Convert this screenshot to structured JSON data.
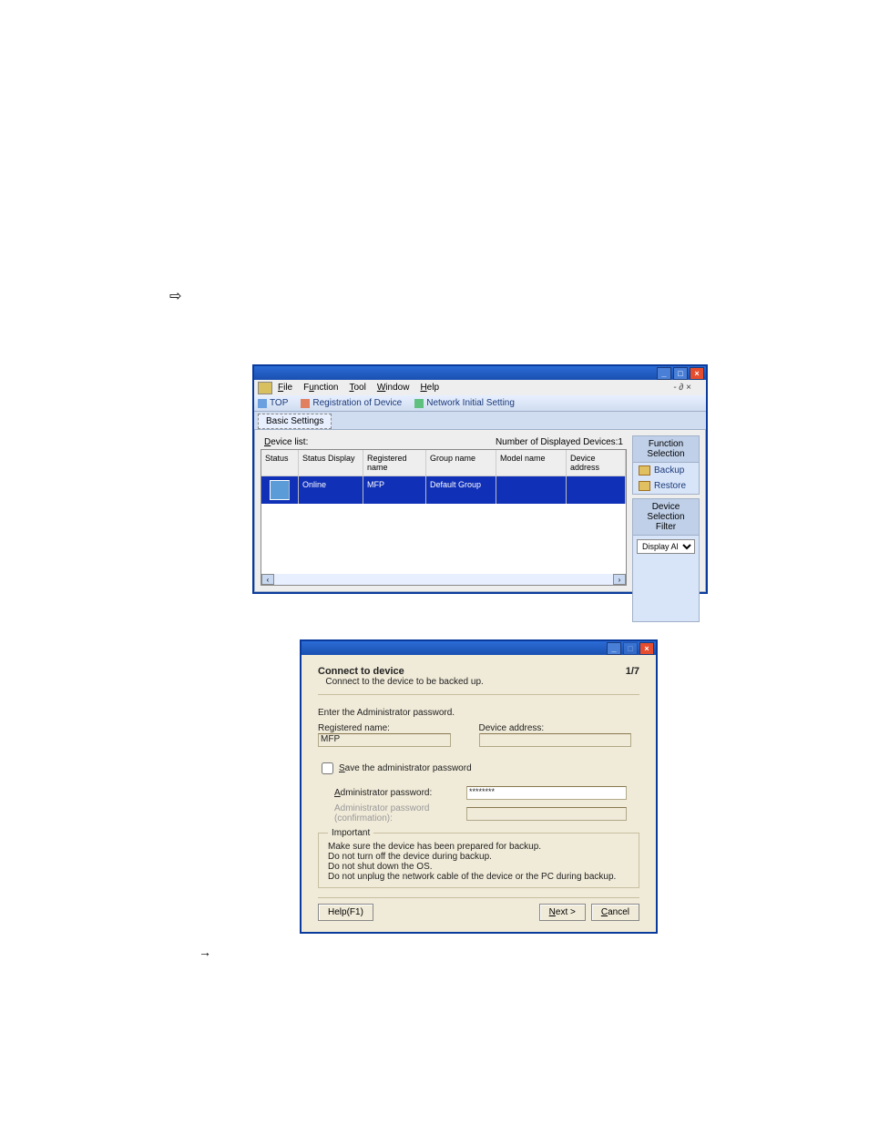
{
  "menu": {
    "file": "File",
    "function": "Function",
    "tool": "Tool",
    "window": "Window",
    "help": "Help"
  },
  "mdi": "-  ∂  ×",
  "toolbar": {
    "top": "TOP",
    "reg": "Registration of Device",
    "net": "Network Initial Setting"
  },
  "tab": "Basic Settings",
  "list": {
    "label": "Device list:",
    "count": "Number of Displayed Devices:1"
  },
  "cols": {
    "c0": "Status",
    "c1": "Status Display",
    "c2": "Registered name",
    "c3": "Group name",
    "c4": "Model name",
    "c5": "Device address"
  },
  "row": {
    "c1": "Online",
    "c2": "MFP",
    "c3": "Default Group",
    "c4": "",
    "c5": ""
  },
  "func": {
    "hdr": "Function Selection",
    "backup": "Backup",
    "restore": "Restore"
  },
  "filter": {
    "hdr": "Device Selection Filter",
    "opt": "Display All"
  },
  "wiz": {
    "title": "Connect to device",
    "sub": "Connect to the device to be backed up.",
    "step": "1/7",
    "enter": "Enter the Administrator password.",
    "regname_l": "Registered name:",
    "regname_v": "MFP",
    "devaddr_l": "Device address:",
    "save": "Save the administrator password",
    "pw_l": "Administrator password:",
    "pw_v": "********",
    "pwc_l": "Administrator password (confirmation):",
    "imp": "Important",
    "w1": "Make sure the device has been prepared for backup.",
    "w2": "Do not turn off the device during backup.",
    "w3": "Do not shut down the OS.",
    "w4": "Do not unplug the network cable of the device or the PC during backup.",
    "help": "Help(F1)",
    "next": "Next >",
    "cancel": "Cancel"
  }
}
